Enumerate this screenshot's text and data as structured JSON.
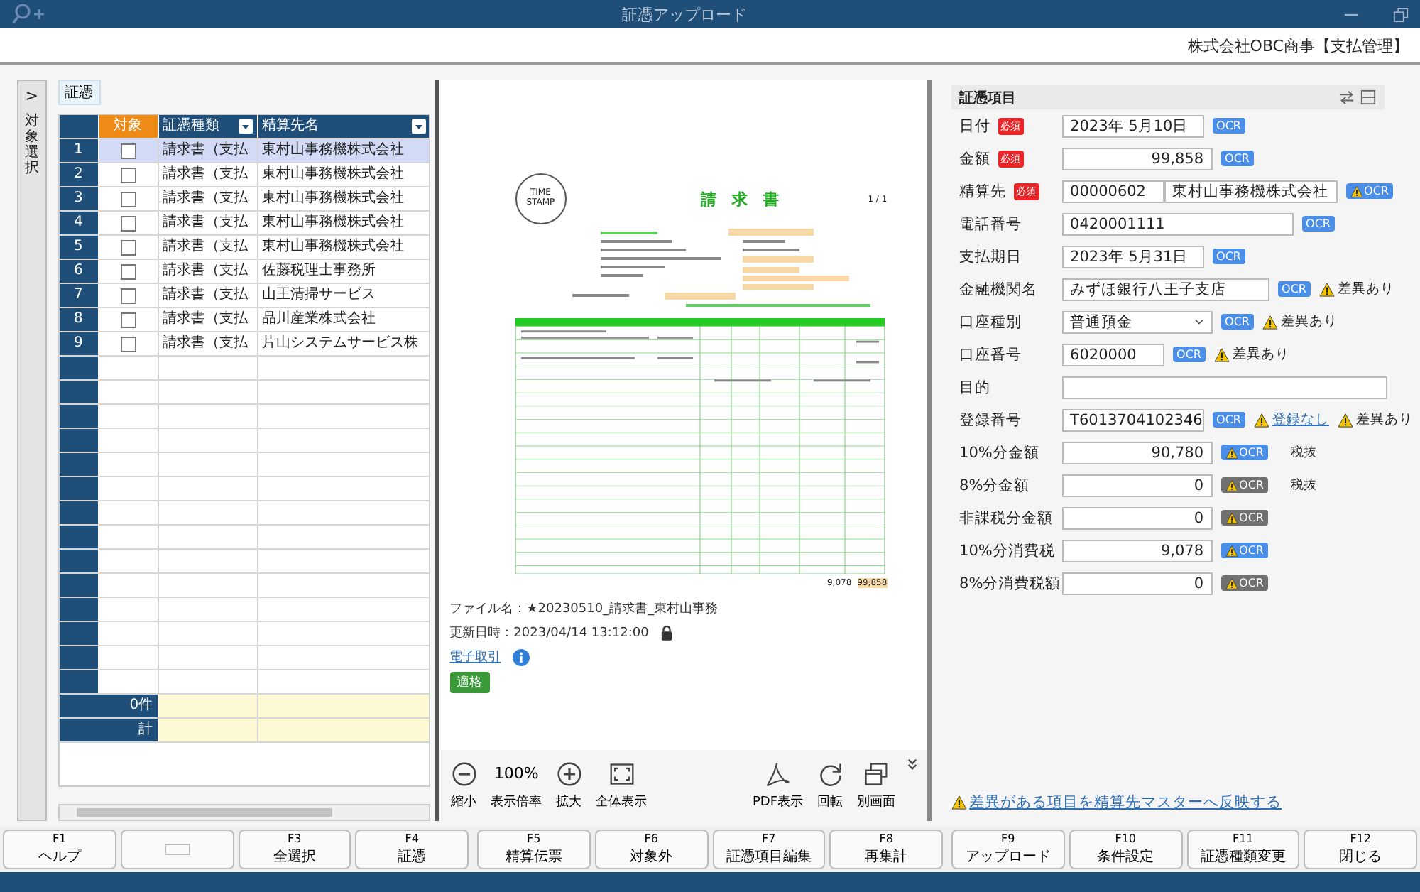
{
  "window": {
    "title": "証憑アップロード"
  },
  "header": {
    "company": "株式会社OBC商事【支払管理】"
  },
  "side_tab": {
    "arrow": ">",
    "label": "対象選択"
  },
  "left": {
    "tab": "証憑",
    "columns": [
      {
        "label": "対象",
        "kind": "check"
      },
      {
        "label": "証憑種類",
        "kind": "filter"
      },
      {
        "label": "精算先名",
        "kind": "filter"
      }
    ],
    "rows": [
      {
        "no": "1",
        "checked": false,
        "type": "請求書（支払",
        "name": "東村山事務機株式会社",
        "selected": true
      },
      {
        "no": "2",
        "checked": false,
        "type": "請求書（支払",
        "name": "東村山事務機株式会社",
        "selected": false
      },
      {
        "no": "3",
        "checked": false,
        "type": "請求書（支払",
        "name": "東村山事務機株式会社",
        "selected": false
      },
      {
        "no": "4",
        "checked": false,
        "type": "請求書（支払",
        "name": "東村山事務機株式会社",
        "selected": false
      },
      {
        "no": "5",
        "checked": false,
        "type": "請求書（支払",
        "name": "東村山事務機株式会社",
        "selected": false
      },
      {
        "no": "6",
        "checked": false,
        "type": "請求書（支払",
        "name": "佐藤税理士事務所",
        "selected": false
      },
      {
        "no": "7",
        "checked": false,
        "type": "請求書（支払",
        "name": "山王清掃サービス",
        "selected": false
      },
      {
        "no": "8",
        "checked": false,
        "type": "請求書（支払",
        "name": "品川産業株式会社",
        "selected": false
      },
      {
        "no": "9",
        "checked": false,
        "type": "請求書（支払",
        "name": "片山システムサービス株",
        "selected": false
      }
    ],
    "count": "0件",
    "total": "計"
  },
  "preview": {
    "document": {
      "stamp": "TIME STAMP",
      "title": "請　求　書",
      "page": "1 / 1",
      "tax_total": "9,078",
      "grand_total": "99,858"
    },
    "file_name": "ファイル名：★20230510_請求書_東村山事務",
    "updated": "更新日時：2023/04/14 13:12:00",
    "link": "電子取引",
    "badge": "適格",
    "tools": [
      {
        "kind": "zoom-out",
        "label": "縮小"
      },
      {
        "kind": "percent",
        "value": "100%",
        "label": "表示倍率"
      },
      {
        "kind": "zoom-in",
        "label": "拡大"
      },
      {
        "kind": "fit",
        "label": "全体表示"
      },
      {
        "kind": "spacer"
      },
      {
        "kind": "pdf",
        "label": "PDF表示"
      },
      {
        "kind": "rotate",
        "label": "回転"
      },
      {
        "kind": "window",
        "label": "別画面"
      }
    ]
  },
  "form": {
    "title": "証憑項目",
    "fields": [
      {
        "label": "日付",
        "required_badge": "必須",
        "inputs": [
          {
            "value": "2023年  5月10日",
            "kind": "date"
          }
        ],
        "ocr": {
          "label": "OCR",
          "active": true,
          "warning": false
        }
      },
      {
        "label": "金額",
        "required_badge": "必須",
        "inputs": [
          {
            "value": "99,858",
            "kind": "amount"
          }
        ],
        "ocr": {
          "label": "OCR",
          "active": true,
          "warning": false
        }
      },
      {
        "label": "精算先",
        "required_badge": "必須",
        "inputs": [
          {
            "value": "00000602",
            "kind": "code"
          },
          {
            "value": "東村山事務機株式会社",
            "kind": "name"
          }
        ],
        "ocr": {
          "label": "OCR",
          "active": true,
          "warning": true
        }
      },
      {
        "label": "電話番号",
        "inputs": [
          {
            "value": "0420001111",
            "kind": "phone"
          }
        ],
        "ocr": {
          "label": "OCR",
          "active": true,
          "warning": false
        }
      },
      {
        "label": "支払期日",
        "inputs": [
          {
            "value": "2023年  5月31日",
            "kind": "date"
          }
        ],
        "ocr": {
          "label": "OCR",
          "active": true,
          "warning": false
        }
      },
      {
        "label": "金融機関名",
        "inputs": [
          {
            "value": "みずほ銀行八王子支店",
            "kind": "bank"
          }
        ],
        "ocr": {
          "label": "OCR",
          "active": true,
          "warning": false
        },
        "notes": [
          {
            "kind": "warning",
            "text": "差異あり"
          }
        ]
      },
      {
        "label": "口座種別",
        "inputs": [
          {
            "value": "普通預金",
            "kind": "select"
          }
        ],
        "ocr": {
          "label": "OCR",
          "active": true,
          "warning": false
        },
        "notes": [
          {
            "kind": "warning",
            "text": "差異あり"
          }
        ]
      },
      {
        "label": "口座番号",
        "inputs": [
          {
            "value": "6020000",
            "kind": "account"
          }
        ],
        "ocr": {
          "label": "OCR",
          "active": true,
          "warning": false
        },
        "notes": [
          {
            "kind": "warning",
            "text": "差異あり"
          }
        ]
      },
      {
        "label": "目的",
        "inputs": [
          {
            "kind": "full"
          }
        ]
      },
      {
        "label": "登録番号",
        "inputs": [
          {
            "value": "T6013704102346",
            "kind": "date"
          }
        ],
        "ocr": {
          "label": "OCR",
          "active": true,
          "warning": false
        },
        "notes": [
          {
            "kind": "link",
            "text": "登録なし"
          },
          {
            "kind": "warning",
            "text": "差異あり"
          }
        ]
      },
      {
        "label": "10%分金額",
        "inputs": [
          {
            "value": "90,780",
            "kind": "amount"
          }
        ],
        "ocr": {
          "label": "OCR",
          "active": true,
          "warning": true
        },
        "notes": [
          {
            "kind": "text",
            "text": "税抜"
          }
        ]
      },
      {
        "label": "8%分金額",
        "inputs": [
          {
            "value": "0",
            "kind": "amount"
          }
        ],
        "ocr": {
          "label": "OCR",
          "active": false,
          "warning": true
        },
        "notes": [
          {
            "kind": "text",
            "text": "税抜"
          }
        ]
      },
      {
        "label": "非課税分金額",
        "inputs": [
          {
            "value": "0",
            "kind": "amount"
          }
        ],
        "ocr": {
          "label": "OCR",
          "active": false,
          "warning": true
        }
      },
      {
        "label": "10%分消費税",
        "inputs": [
          {
            "value": "9,078",
            "kind": "amount"
          }
        ],
        "ocr": {
          "label": "OCR",
          "active": true,
          "warning": true
        }
      },
      {
        "label": "8%分消費税額",
        "inputs": [
          {
            "value": "0",
            "kind": "amount"
          }
        ],
        "ocr": {
          "label": "OCR",
          "active": false,
          "warning": true
        }
      }
    ],
    "reflect_link": "差異がある項目を精算先マスターへ反映する"
  },
  "function_key_groups": [
    [
      {
        "key": "F1",
        "label": "ヘルプ"
      },
      {
        "kind": "blank"
      },
      {
        "key": "F3",
        "label": "全選択"
      },
      {
        "key": "F4",
        "label": "証憑"
      }
    ],
    [
      {
        "key": "F5",
        "label": "精算伝票"
      },
      {
        "key": "F6",
        "label": "対象外"
      },
      {
        "key": "F7",
        "label": "証憑項目編集"
      },
      {
        "key": "F8",
        "label": "再集計"
      }
    ],
    [
      {
        "key": "F9",
        "label": "アップロード"
      },
      {
        "key": "F10",
        "label": "条件設定"
      },
      {
        "key": "F11",
        "label": "証憑種類変更"
      },
      {
        "key": "F12",
        "label": "閉じる"
      }
    ]
  ]
}
